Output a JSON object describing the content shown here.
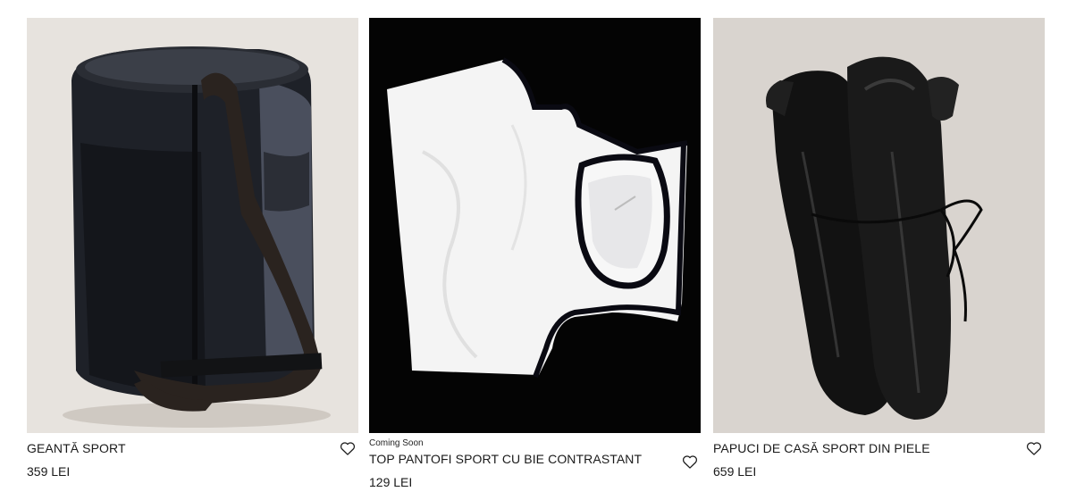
{
  "products": [
    {
      "badge": "",
      "title": "GEANTĂ SPORT",
      "price": "359 LEI",
      "image": "black-nylon-leather-sport-bag",
      "favorite_icon": "heart-outline-icon"
    },
    {
      "badge": "Coming Soon",
      "title": "TOP PANTOFI SPORT CU BIE CONTRASTANT",
      "price": "129 LEI",
      "image": "white-crop-top-black-trim",
      "favorite_icon": "heart-outline-icon"
    },
    {
      "badge": "",
      "title": "PAPUCI DE CASĂ SPORT DIN PIELE",
      "price": "659 LEI",
      "image": "black-leather-sneakers",
      "favorite_icon": "heart-outline-icon"
    }
  ],
  "colors": {
    "bag_background": "#e6e2dd",
    "top_background": "#050505",
    "shoe_background": "#d9d4cf",
    "text": "#1a1a1a"
  }
}
